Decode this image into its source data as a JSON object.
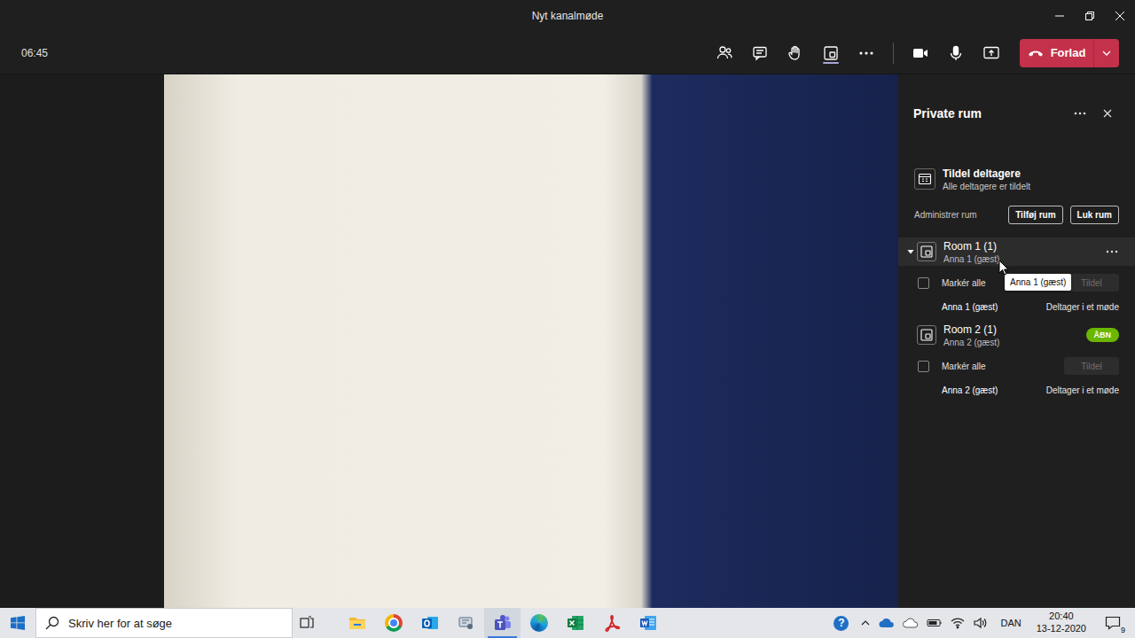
{
  "window": {
    "title": "Nyt kanalmøde"
  },
  "toolbar": {
    "time": "06:45",
    "items": [
      {
        "kind": "participants",
        "selected": false
      },
      {
        "kind": "chat",
        "selected": false
      },
      {
        "kind": "raise-hand",
        "selected": false
      },
      {
        "kind": "breakout-rooms",
        "selected": true
      },
      {
        "kind": "more",
        "selected": false
      }
    ],
    "devices": [
      {
        "kind": "camera",
        "on": true
      },
      {
        "kind": "microphone",
        "on": true
      },
      {
        "kind": "share",
        "on": true
      }
    ],
    "leave_button": "Forlad"
  },
  "panel": {
    "title": "Private rum",
    "assign": {
      "title": "Tildel deltagere",
      "subtitle": "Alle deltagere er tildelt"
    },
    "manage": {
      "label": "Administrer rum",
      "buttons": [
        "Tilføj rum",
        "Luk rum"
      ]
    },
    "rooms": [
      {
        "name": "Room 1 (1)",
        "summary": "Anna 1 (gæst)",
        "expanded": true,
        "hovered": true,
        "open": false,
        "select_all": {
          "label": "Markér alle",
          "checked": false
        },
        "assign_button": {
          "label": "Tildel",
          "disabled": true
        },
        "members": [
          {
            "name": "Anna 1 (gæst)",
            "status": "Deltager i et møde"
          }
        ]
      },
      {
        "name": "Room 2 (1)",
        "summary": "Anna 2 (gæst)",
        "expanded": true,
        "hovered": false,
        "open": true,
        "badge": "ÅBN",
        "select_all": {
          "label": "Markér alle",
          "checked": false
        },
        "assign_button": {
          "label": "Tildel",
          "disabled": true
        },
        "members": [
          {
            "name": "Anna 2 (gæst)",
            "status": "Deltager i et møde"
          }
        ]
      }
    ],
    "tooltip": {
      "text": "Anna 1 (gæst)"
    }
  },
  "taskbar": {
    "search_placeholder": "Skriv her for at søge",
    "apps": [
      {
        "kind": "task-view",
        "selected": false
      },
      {
        "kind": "file-explorer",
        "selected": false
      },
      {
        "kind": "chrome",
        "selected": false
      },
      {
        "kind": "outlook",
        "selected": false
      },
      {
        "kind": "snipping-tool",
        "selected": false
      },
      {
        "kind": "teams",
        "selected": true
      },
      {
        "kind": "edge",
        "selected": false
      },
      {
        "kind": "excel",
        "selected": false
      },
      {
        "kind": "acrobat",
        "selected": false
      },
      {
        "kind": "word",
        "selected": false
      }
    ],
    "tray": {
      "help": "?",
      "language": "DAN",
      "time": "20:40",
      "date": "13-12-2020",
      "notifications": "9"
    }
  }
}
